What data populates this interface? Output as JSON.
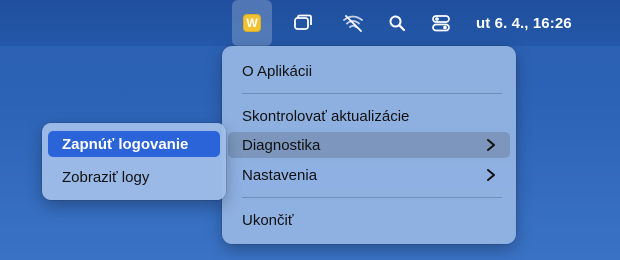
{
  "menubar": {
    "app_icon_letter": "W",
    "icons": [
      "window-icon",
      "wifi-off-icon",
      "search-icon",
      "control-center-icon"
    ],
    "clock": "ut 6. 4., 16:26"
  },
  "menu": {
    "items": [
      {
        "label": "O Aplikácii"
      },
      {
        "label": "Skontrolovať aktualizácie"
      },
      {
        "label": "Diagnostika"
      },
      {
        "label": "Nastavenia"
      },
      {
        "label": "Ukončiť"
      }
    ]
  },
  "submenu": {
    "items": [
      {
        "label": "Zapnúť logovanie"
      },
      {
        "label": "Zobraziť logy"
      }
    ]
  },
  "colors": {
    "accent": "#2a64d8",
    "desktop": "#2d63b6",
    "app_icon": "#f2c230"
  }
}
